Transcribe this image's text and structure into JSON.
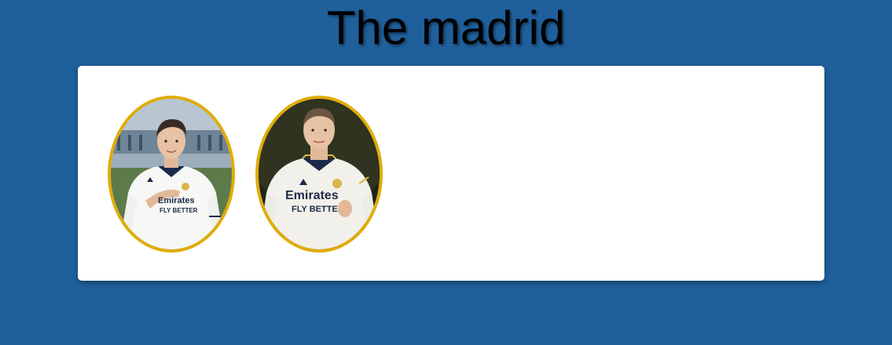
{
  "page": {
    "title": "The madrid"
  },
  "colors": {
    "background": "#1f609c",
    "card": "#ffffff",
    "avatar_border": "#e0ac07"
  },
  "players": [
    {
      "name_icon": "player-photo-1",
      "jersey_sponsor_line1": "Emirates",
      "jersey_sponsor_line2": "FLY BETTER"
    },
    {
      "name_icon": "player-photo-2",
      "jersey_sponsor_line1": "Emirates",
      "jersey_sponsor_line2": "FLY BETTER"
    }
  ]
}
